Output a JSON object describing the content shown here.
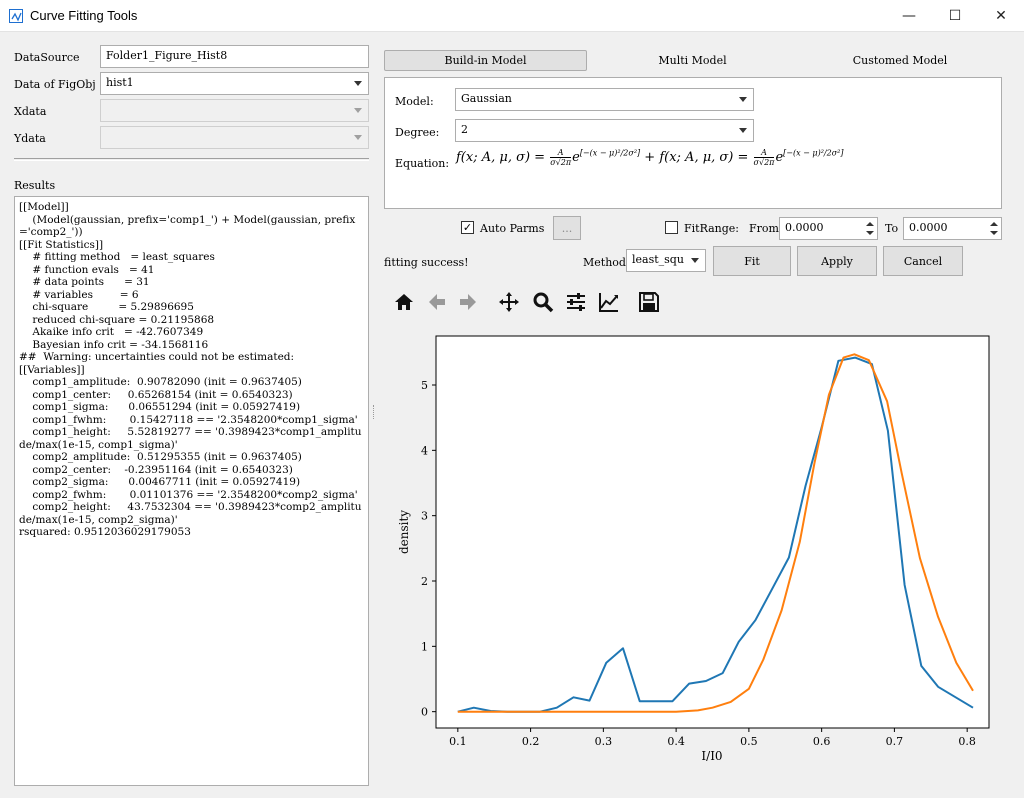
{
  "window": {
    "title": "Curve Fitting Tools",
    "minimize": "—",
    "maximize": "☐",
    "close": "✕"
  },
  "left": {
    "datasource_label": "DataSource",
    "datasource_value": "Folder1_Figure_Hist8",
    "figobj_label": "Data of FigObj",
    "figobj_value": "hist1",
    "xdata_label": "Xdata",
    "xdata_value": "",
    "ydata_label": "Ydata",
    "ydata_value": "",
    "results_label": "Results",
    "results_text": "[[Model]]\n    (Model(gaussian, prefix='comp1_') + Model(gaussian, prefix='comp2_'))\n[[Fit Statistics]]\n    # fitting method   = least_squares\n    # function evals   = 41\n    # data points      = 31\n    # variables        = 6\n    chi-square         = 5.29896695\n    reduced chi-square = 0.21195868\n    Akaike info crit   = -42.7607349\n    Bayesian info crit = -34.1568116\n##  Warning: uncertainties could not be estimated:\n[[Variables]]\n    comp1_amplitude:  0.90782090 (init = 0.9637405)\n    comp1_center:     0.65268154 (init = 0.6540323)\n    comp1_sigma:      0.06551294 (init = 0.05927419)\n    comp1_fwhm:       0.15427118 == '2.3548200*comp1_sigma'\n    comp1_height:     5.52819277 == '0.3989423*comp1_amplitude/max(1e-15, comp1_sigma)'\n    comp2_amplitude:  0.51295355 (init = 0.9637405)\n    comp2_center:    -0.23951164 (init = 0.6540323)\n    comp2_sigma:      0.00467711 (init = 0.05927419)\n    comp2_fwhm:       0.01101376 == '2.3548200*comp2_sigma'\n    comp2_height:     43.7532304 == '0.3989423*comp2_amplitude/max(1e-15, comp2_sigma)'\nrsquared: 0.9512036029179053"
  },
  "tabs": [
    {
      "label": "Build-in Model",
      "active": true
    },
    {
      "label": "Multi Model",
      "active": false
    },
    {
      "label": "Customed Model",
      "active": false
    }
  ],
  "model": {
    "model_label": "Model:",
    "model_value": "Gaussian",
    "degree_label": "Degree:",
    "degree_value": "2",
    "equation_label": "Equation:"
  },
  "controls": {
    "auto_parms_label": "Auto Parms",
    "auto_parms_checked": "✓",
    "ellipsis": "...",
    "fitrange_label": "FitRange:",
    "from_label": "From",
    "from_value": "0.0000",
    "to_label": "To",
    "to_value": "0.0000",
    "status": "fitting success!",
    "method_label": "Method",
    "method_value": "least_squ",
    "fit_button": "Fit",
    "apply_button": "Apply",
    "cancel_button": "Cancel"
  },
  "chart_data": {
    "type": "line",
    "xlabel": "I/I0",
    "ylabel": "density",
    "xlim": [
      0.07,
      0.83
    ],
    "ylim": [
      -0.25,
      5.75
    ],
    "xticks": [
      "0.1",
      "0.2",
      "0.3",
      "0.4",
      "0.5",
      "0.6",
      "0.7",
      "0.8"
    ],
    "yticks": [
      "0",
      "1",
      "2",
      "3",
      "4",
      "5"
    ],
    "series": [
      {
        "color": "#1f77b4",
        "x": [
          0.1,
          0.122,
          0.145,
          0.168,
          0.19,
          0.213,
          0.236,
          0.259,
          0.281,
          0.304,
          0.327,
          0.35,
          0.373,
          0.395,
          0.418,
          0.441,
          0.464,
          0.486,
          0.509,
          0.532,
          0.555,
          0.578,
          0.6,
          0.623,
          0.646,
          0.669,
          0.691,
          0.714,
          0.737,
          0.76,
          0.808
        ],
        "y": [
          0.0,
          0.06,
          0.01,
          0.0,
          0.0,
          0.0,
          0.06,
          0.22,
          0.17,
          0.75,
          0.97,
          0.16,
          0.16,
          0.16,
          0.43,
          0.47,
          0.59,
          1.07,
          1.4,
          1.88,
          2.36,
          3.46,
          4.35,
          5.37,
          5.42,
          5.32,
          4.3,
          1.94,
          0.7,
          0.38,
          0.06
        ]
      },
      {
        "color": "#ff7f0e",
        "x": [
          0.1,
          0.14,
          0.2,
          0.3,
          0.4,
          0.43,
          0.45,
          0.475,
          0.5,
          0.52,
          0.545,
          0.57,
          0.59,
          0.61,
          0.63,
          0.645,
          0.665,
          0.69,
          0.71,
          0.735,
          0.76,
          0.785,
          0.808
        ],
        "y": [
          0.0,
          0.0,
          0.0,
          0.0,
          0.0,
          0.02,
          0.06,
          0.15,
          0.35,
          0.8,
          1.55,
          2.6,
          3.8,
          4.85,
          5.42,
          5.47,
          5.38,
          4.75,
          3.65,
          2.35,
          1.45,
          0.75,
          0.32
        ]
      }
    ]
  }
}
